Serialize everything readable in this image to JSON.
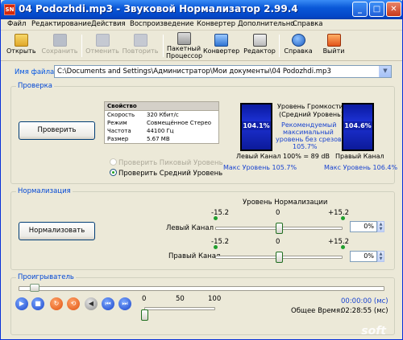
{
  "window": {
    "title": "04 Podozhdi.mp3 - Звуковой Нормализатор 2.99.4",
    "icon_text": "SN"
  },
  "titlebar_buttons": {
    "minimize": "_",
    "maximize": "□",
    "close": "✕"
  },
  "menu": [
    "Файл",
    "Редактирование",
    "Действия",
    "Воспроизведение",
    "Конвертер",
    "Дополнительно",
    "Справка"
  ],
  "toolbar": {
    "open": "Открыть",
    "save": "Сохранить",
    "undo": "Отменить",
    "redo": "Повторить",
    "batch_l1": "Пакетный",
    "batch_l2": "Процессор",
    "converter": "Конвертер",
    "editor": "Редактор",
    "help": "Справка",
    "exit": "Выйти"
  },
  "file": {
    "label": "Имя файла:",
    "path": "C:\\Documents and Settings\\Администратор\\Мои документы\\04 Podozhdi.mp3"
  },
  "check": {
    "group_title": "Проверка",
    "button": "Проверить",
    "table_header": "Свойство",
    "props": [
      {
        "k": "Скорость",
        "v": "320 Кбит/с"
      },
      {
        "k": "Режим",
        "v": "Совмещённое Стерео"
      },
      {
        "k": "Частота",
        "v": "44100 Гц"
      },
      {
        "k": "Размер",
        "v": "5.67 MB"
      }
    ],
    "radio_peak": "Проверить Пиковый Уровень",
    "radio_avg": "Проверить Средний Уровень",
    "selected_radio": "avg"
  },
  "levels": {
    "left_value": "104.1%",
    "right_value": "104.6%",
    "title_l1": "Уровень Громкости",
    "title_l2": "(Средний Уровень)",
    "rec_l1": "Рекомендуемый",
    "rec_l2": "максимальный",
    "rec_l3": "уровень без срезов",
    "rec_l4": "105.7%",
    "left_caption": "Левый Канал",
    "right_caption": "Правый Канал",
    "center_db": "100% = 89 dB",
    "max_left": "Макс Уровень 105.7%",
    "max_right": "Макс Уровень 106.4%"
  },
  "normalize": {
    "group_title": "Нормализация",
    "button": "Нормализовать",
    "header": "Уровень Нормализации",
    "min": "-15.2",
    "mid": "0",
    "max": "+15.2",
    "left_label": "Левый Канал",
    "right_label": "Правый Канал",
    "left_pct": "0%",
    "right_pct": "0%",
    "left_value": 0,
    "right_value": 0
  },
  "player": {
    "group_title": "Проигрыватель",
    "position_fraction": 0.03,
    "vol_0": "0",
    "vol_50": "50",
    "vol_100": "100",
    "volume": 0,
    "time_current": "00:00:00 (мс)",
    "total_label": "Общее Время:",
    "time_total": "02:28:55 (мс)"
  },
  "colors": {
    "accent": "#0046d5",
    "meter": "#1d32d6",
    "title_bar": "#0a58d8"
  },
  "watermark": "soft"
}
